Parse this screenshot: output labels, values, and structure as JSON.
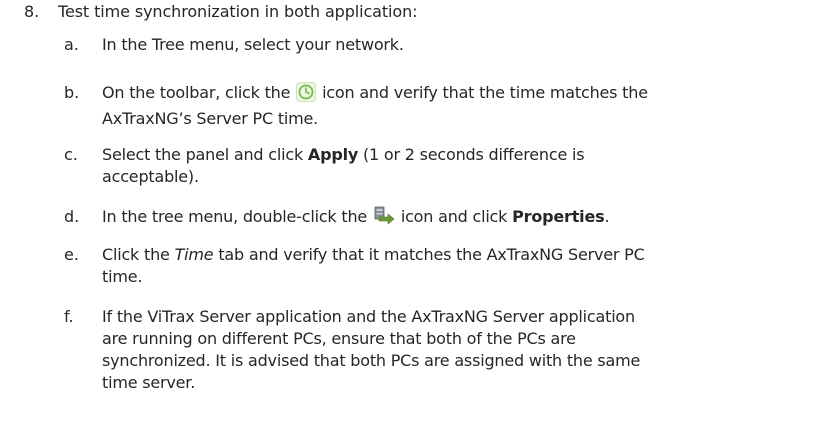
{
  "step": {
    "number": "8.",
    "text": "Test time synchronization in both application:"
  },
  "substeps": {
    "a": {
      "letter": "a.",
      "text": "In the Tree menu, select your network."
    },
    "b": {
      "letter": "b.",
      "pre": "On the toolbar, click the",
      "post": "icon and verify that the time matches the",
      "line2": "AxTraxNG’s Server PC time.",
      "icon": "clock-icon"
    },
    "c": {
      "letter": "c.",
      "pre": "Select the panel and click",
      "bold": "Apply",
      "post": "(1 or 2 seconds difference is",
      "line2": "acceptable)."
    },
    "d": {
      "letter": "d.",
      "pre": "In the tree menu, double-click the",
      "post": "icon and click",
      "bold": "Properties",
      "end": ".",
      "icon": "panel-arrow-icon"
    },
    "e": {
      "letter": "e.",
      "italic": "Time",
      "pre": "Click the",
      "post": "tab and verify that it matches the AxTraxNG Server PC",
      "line2": "time."
    },
    "f": {
      "letter": "f.",
      "lines": [
        "If the ViTrax Server application and the AxTraxNG Server application",
        "are running on different PCs, ensure that both of the PCs are",
        "synchronized. It is advised that both PCs are assigned with the same",
        "time server."
      ]
    }
  },
  "colors": {
    "text": "#262626",
    "clock_icon": "#7ab848",
    "panel_icon": "#6a9a34"
  }
}
